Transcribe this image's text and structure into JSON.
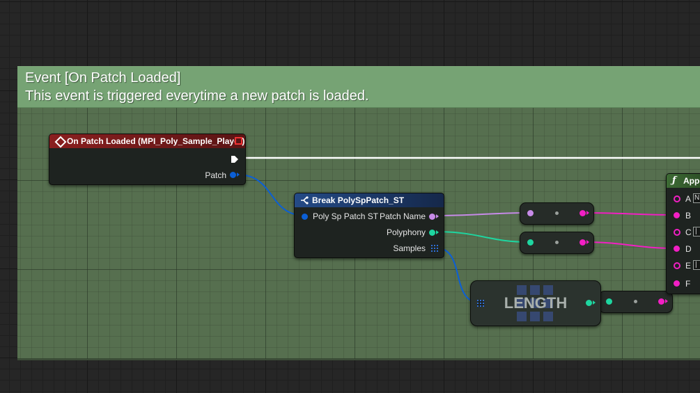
{
  "comment": {
    "title": "Event [On Patch Loaded]",
    "description": "This event is triggered everytime a new patch is loaded."
  },
  "event_node": {
    "title": "On Patch Loaded (MPI_Poly_Sample_Player)",
    "output_pin": "Patch",
    "header_color": "#7a1c1c",
    "icon": "event-diamond-icon"
  },
  "break_node": {
    "title": "Break PolySpPatch_ST",
    "input_pin": "Poly Sp Patch ST",
    "outputs": [
      "Patch Name",
      "Polyphony",
      "Samples"
    ],
    "header_color": "#1c3a66",
    "icon": "break-struct-icon"
  },
  "length_node": {
    "label": "LENGTH",
    "icon": "array-grid-icon"
  },
  "append_node": {
    "title": "Appe",
    "icon": "function-icon",
    "pins": [
      "A",
      "B",
      "C",
      "D",
      "E",
      "F"
    ],
    "literal_a": "N",
    "literal_c": "|",
    "literal_e": "|"
  },
  "colors": {
    "exec_wire": "#ffffff",
    "struct_pin": "#0b5fd6",
    "name_pin": "#c78be8",
    "int_pin": "#1ed6a0",
    "string_pin": "#f21fc4",
    "comment_header": "#76a374",
    "comment_body": "#566f4f"
  }
}
